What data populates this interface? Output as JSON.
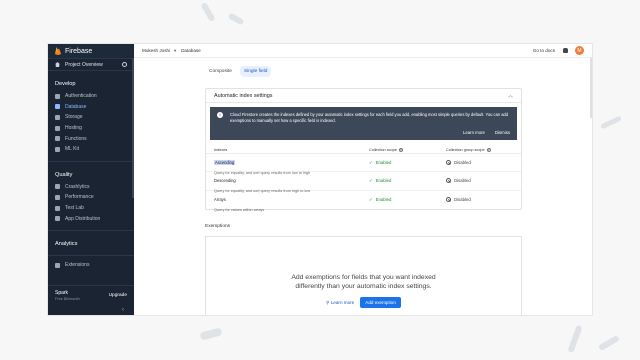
{
  "app": {
    "brand": "Firebase",
    "project_overview": "Project Overview"
  },
  "sidebar": {
    "sections": [
      {
        "title": "Develop",
        "items": [
          {
            "label": "Authentication",
            "icon": "people-icon"
          },
          {
            "label": "Database",
            "icon": "database-icon",
            "active": true
          },
          {
            "label": "Storage",
            "icon": "storage-icon"
          },
          {
            "label": "Hosting",
            "icon": "hosting-icon"
          },
          {
            "label": "Functions",
            "icon": "functions-icon"
          },
          {
            "label": "ML Kit",
            "icon": "ml-kit-icon"
          }
        ]
      },
      {
        "title": "Quality",
        "items": [
          {
            "label": "Crashlytics",
            "icon": "crashlytics-icon"
          },
          {
            "label": "Performance",
            "icon": "performance-icon"
          },
          {
            "label": "Test Lab",
            "icon": "test-lab-icon"
          },
          {
            "label": "App Distribution",
            "icon": "app-distribution-icon"
          }
        ]
      },
      {
        "title": "Analytics",
        "items": []
      },
      {
        "title": "",
        "items": [
          {
            "label": "Extensions",
            "icon": "extensions-icon"
          }
        ]
      }
    ],
    "plan": {
      "name": "Spark",
      "price": "Free $0/month",
      "upgrade": "Upgrade"
    },
    "collapse": "‹"
  },
  "topbar": {
    "user": "Mukesh Joshi",
    "crumb": "Database",
    "docs": "Go to docs",
    "avatar_letter": "M"
  },
  "tabs": [
    "Composite",
    "Single field"
  ],
  "auto_index": {
    "title": "Automatic index settings",
    "banner_text": "Cloud Firestore creates the indexes defined by your automatic index settings for each field you add, enabling most simple queries by default. You can add exemptions to manually set how a specific field is indexed.",
    "learn_more": "Learn more",
    "dismiss": "Dismiss",
    "columns": [
      "Indexes",
      "Collection scope",
      "Collection group scope"
    ],
    "rows": [
      {
        "name": "Ascending",
        "desc": "Query for equality, and sort query results from low to high",
        "collection": "Enabled",
        "group": "Disabled"
      },
      {
        "name": "Descending",
        "desc": "Query for equality, and sort query results from high to low",
        "collection": "Enabled",
        "group": "Disabled"
      },
      {
        "name": "Arrays",
        "desc": "Query for values within arrays",
        "collection": "Enabled",
        "group": "Disabled"
      }
    ]
  },
  "exemptions": {
    "title": "Exemptions",
    "message": "Add exemptions for fields that you want indexed differently than your automatic index settings.",
    "learn_more": "Learn more",
    "add": "Add exemption"
  },
  "colors": {
    "sidebar": "#1a2433",
    "accent": "#1a73e8",
    "enabled": "#1e8e3e",
    "avatar": "#f07b39"
  }
}
